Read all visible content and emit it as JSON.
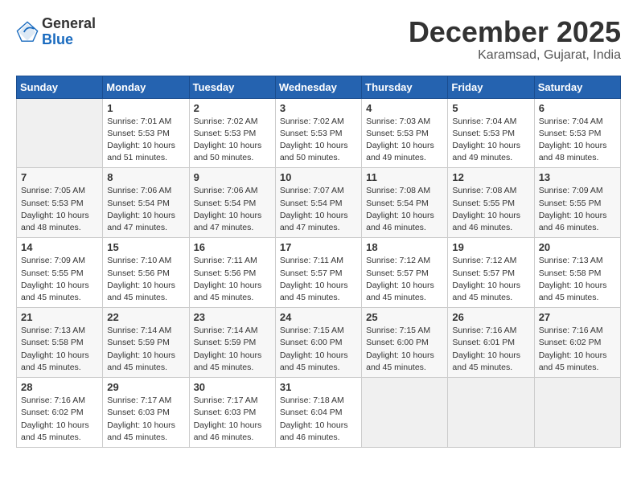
{
  "header": {
    "logo_general": "General",
    "logo_blue": "Blue",
    "month_title": "December 2025",
    "subtitle": "Karamsad, Gujarat, India"
  },
  "days_of_week": [
    "Sunday",
    "Monday",
    "Tuesday",
    "Wednesday",
    "Thursday",
    "Friday",
    "Saturday"
  ],
  "weeks": [
    [
      {
        "num": "",
        "empty": true
      },
      {
        "num": "1",
        "sunrise": "7:01 AM",
        "sunset": "5:53 PM",
        "daylight": "10 hours and 51 minutes."
      },
      {
        "num": "2",
        "sunrise": "7:02 AM",
        "sunset": "5:53 PM",
        "daylight": "10 hours and 50 minutes."
      },
      {
        "num": "3",
        "sunrise": "7:02 AM",
        "sunset": "5:53 PM",
        "daylight": "10 hours and 50 minutes."
      },
      {
        "num": "4",
        "sunrise": "7:03 AM",
        "sunset": "5:53 PM",
        "daylight": "10 hours and 49 minutes."
      },
      {
        "num": "5",
        "sunrise": "7:04 AM",
        "sunset": "5:53 PM",
        "daylight": "10 hours and 49 minutes."
      },
      {
        "num": "6",
        "sunrise": "7:04 AM",
        "sunset": "5:53 PM",
        "daylight": "10 hours and 48 minutes."
      }
    ],
    [
      {
        "num": "7",
        "sunrise": "7:05 AM",
        "sunset": "5:53 PM",
        "daylight": "10 hours and 48 minutes."
      },
      {
        "num": "8",
        "sunrise": "7:06 AM",
        "sunset": "5:54 PM",
        "daylight": "10 hours and 47 minutes."
      },
      {
        "num": "9",
        "sunrise": "7:06 AM",
        "sunset": "5:54 PM",
        "daylight": "10 hours and 47 minutes."
      },
      {
        "num": "10",
        "sunrise": "7:07 AM",
        "sunset": "5:54 PM",
        "daylight": "10 hours and 47 minutes."
      },
      {
        "num": "11",
        "sunrise": "7:08 AM",
        "sunset": "5:54 PM",
        "daylight": "10 hours and 46 minutes."
      },
      {
        "num": "12",
        "sunrise": "7:08 AM",
        "sunset": "5:55 PM",
        "daylight": "10 hours and 46 minutes."
      },
      {
        "num": "13",
        "sunrise": "7:09 AM",
        "sunset": "5:55 PM",
        "daylight": "10 hours and 46 minutes."
      }
    ],
    [
      {
        "num": "14",
        "sunrise": "7:09 AM",
        "sunset": "5:55 PM",
        "daylight": "10 hours and 45 minutes."
      },
      {
        "num": "15",
        "sunrise": "7:10 AM",
        "sunset": "5:56 PM",
        "daylight": "10 hours and 45 minutes."
      },
      {
        "num": "16",
        "sunrise": "7:11 AM",
        "sunset": "5:56 PM",
        "daylight": "10 hours and 45 minutes."
      },
      {
        "num": "17",
        "sunrise": "7:11 AM",
        "sunset": "5:57 PM",
        "daylight": "10 hours and 45 minutes."
      },
      {
        "num": "18",
        "sunrise": "7:12 AM",
        "sunset": "5:57 PM",
        "daylight": "10 hours and 45 minutes."
      },
      {
        "num": "19",
        "sunrise": "7:12 AM",
        "sunset": "5:57 PM",
        "daylight": "10 hours and 45 minutes."
      },
      {
        "num": "20",
        "sunrise": "7:13 AM",
        "sunset": "5:58 PM",
        "daylight": "10 hours and 45 minutes."
      }
    ],
    [
      {
        "num": "21",
        "sunrise": "7:13 AM",
        "sunset": "5:58 PM",
        "daylight": "10 hours and 45 minutes."
      },
      {
        "num": "22",
        "sunrise": "7:14 AM",
        "sunset": "5:59 PM",
        "daylight": "10 hours and 45 minutes."
      },
      {
        "num": "23",
        "sunrise": "7:14 AM",
        "sunset": "5:59 PM",
        "daylight": "10 hours and 45 minutes."
      },
      {
        "num": "24",
        "sunrise": "7:15 AM",
        "sunset": "6:00 PM",
        "daylight": "10 hours and 45 minutes."
      },
      {
        "num": "25",
        "sunrise": "7:15 AM",
        "sunset": "6:00 PM",
        "daylight": "10 hours and 45 minutes."
      },
      {
        "num": "26",
        "sunrise": "7:16 AM",
        "sunset": "6:01 PM",
        "daylight": "10 hours and 45 minutes."
      },
      {
        "num": "27",
        "sunrise": "7:16 AM",
        "sunset": "6:02 PM",
        "daylight": "10 hours and 45 minutes."
      }
    ],
    [
      {
        "num": "28",
        "sunrise": "7:16 AM",
        "sunset": "6:02 PM",
        "daylight": "10 hours and 45 minutes."
      },
      {
        "num": "29",
        "sunrise": "7:17 AM",
        "sunset": "6:03 PM",
        "daylight": "10 hours and 45 minutes."
      },
      {
        "num": "30",
        "sunrise": "7:17 AM",
        "sunset": "6:03 PM",
        "daylight": "10 hours and 46 minutes."
      },
      {
        "num": "31",
        "sunrise": "7:18 AM",
        "sunset": "6:04 PM",
        "daylight": "10 hours and 46 minutes."
      },
      {
        "num": "",
        "empty": true
      },
      {
        "num": "",
        "empty": true
      },
      {
        "num": "",
        "empty": true
      }
    ]
  ],
  "labels": {
    "sunrise": "Sunrise:",
    "sunset": "Sunset:",
    "daylight": "Daylight:"
  }
}
